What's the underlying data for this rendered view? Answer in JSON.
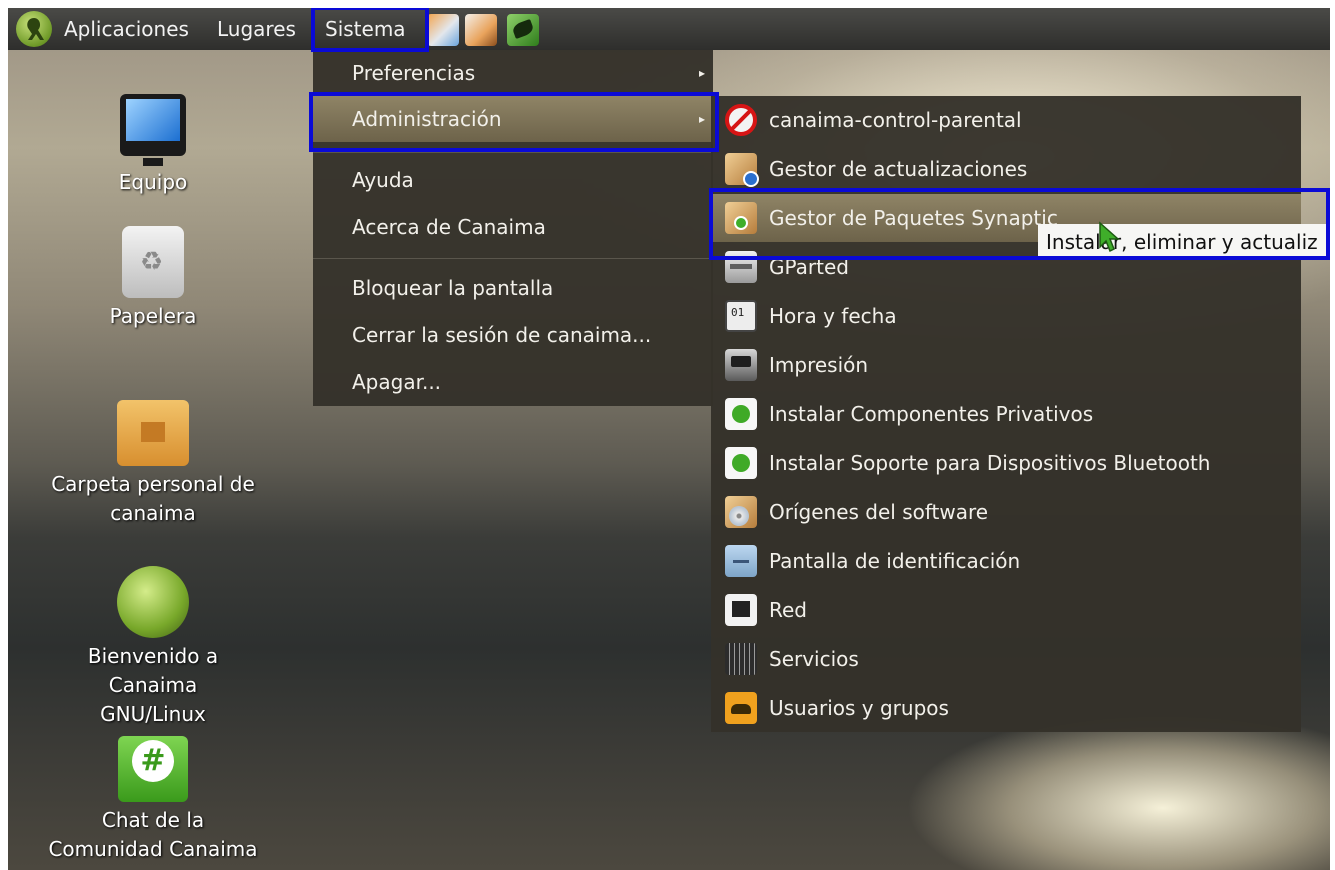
{
  "panel": {
    "menus": [
      "Aplicaciones",
      "Lugares",
      "Sistema"
    ],
    "logo_icon": "canaima-logo-icon",
    "launchers": [
      "firefox-icon",
      "file-manager-icon",
      "leaf-icon"
    ]
  },
  "system_menu": {
    "items": [
      {
        "label": "Preferencias",
        "arrow": "▸"
      },
      {
        "label": "Administración",
        "arrow": "▸"
      },
      {
        "label": "Ayuda"
      },
      {
        "label": "Acerca de Canaima"
      },
      {
        "label": "Bloquear la pantalla"
      },
      {
        "label": "Cerrar la sesión de canaima..."
      },
      {
        "label": "Apagar..."
      }
    ]
  },
  "admin_menu": {
    "items": [
      {
        "label": "canaima-control-parental",
        "icon": "no-entry-icon"
      },
      {
        "label": "Gestor de actualizaciones",
        "icon": "update-manager-icon"
      },
      {
        "label": "Gestor de Paquetes Synaptic",
        "icon": "package-install-icon"
      },
      {
        "label": "GParted",
        "icon": "disk-icon"
      },
      {
        "label": "Hora y fecha",
        "icon": "calendar-icon"
      },
      {
        "label": "Impresión",
        "icon": "printer-icon"
      },
      {
        "label": "Instalar Componentes Privativos",
        "icon": "green-circle-icon"
      },
      {
        "label": "Instalar Soporte para Dispositivos Bluetooth",
        "icon": "green-circle-icon"
      },
      {
        "label": "Orígenes del software",
        "icon": "software-sources-icon"
      },
      {
        "label": "Pantalla de identificación",
        "icon": "login-screen-icon"
      },
      {
        "label": "Red",
        "icon": "network-icon"
      },
      {
        "label": "Servicios",
        "icon": "services-icon"
      },
      {
        "label": "Usuarios y grupos",
        "icon": "users-icon"
      }
    ]
  },
  "tooltip": "Instalar, eliminar y actualiz",
  "desktop_icons": [
    {
      "label": "Equipo",
      "icon": "computer-icon"
    },
    {
      "label": "Papelera",
      "icon": "trash-icon"
    },
    {
      "label": "Carpeta personal de canaima",
      "icon": "home-folder-icon"
    },
    {
      "label": "Bienvenido a Canaima GNU/Linux",
      "icon": "welcome-icon"
    },
    {
      "label": "Chat de la Comunidad Canaima",
      "icon": "chat-icon"
    }
  ],
  "colors": {
    "highlight_box": "#0a0ad6",
    "menu_bg": "#34312a",
    "menu_active": "#8f8466"
  }
}
